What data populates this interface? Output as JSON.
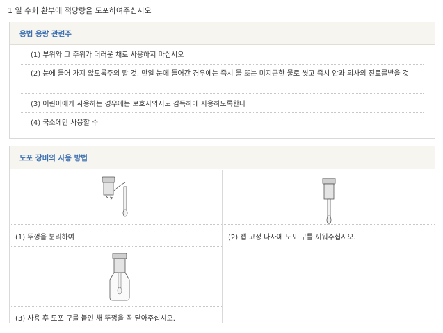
{
  "header": {
    "instruction": "1 일 수회 환부에 적당량을 도포하여주십시오"
  },
  "usage_section": {
    "title": "용법 용량 관련주",
    "items": [
      "(1) 부위와 그 주위가 더러운 채로 사용하지 마십시오",
      "(2) 눈에 들어 가지 않도록주의 할 것. 만일 눈에 들어간 경우에는 즉시 물 또는 미지근한 물로 씻고 즉시 안과 의사의 진료를받을 것",
      "(3) 어린이에게 사용하는 경우에는 보호자의지도 감독하에 사용하도록한다",
      "(4) 국소에만 사용할 수"
    ]
  },
  "device_section": {
    "title": "도포 장비의 사용 방법",
    "steps": [
      {
        "caption": "(1) 뚜껑을 분리하여",
        "icon": "cap-removed-icon"
      },
      {
        "caption": "(2) 캡 고정 나사에 도포 구를 끼워주십시오.",
        "icon": "applicator-attached-icon"
      },
      {
        "caption": "(3) 사용 후 도포 구를 붙인 채 뚜껑을 꼭 닫아주십시오.",
        "icon": "bottle-closed-icon"
      }
    ]
  }
}
